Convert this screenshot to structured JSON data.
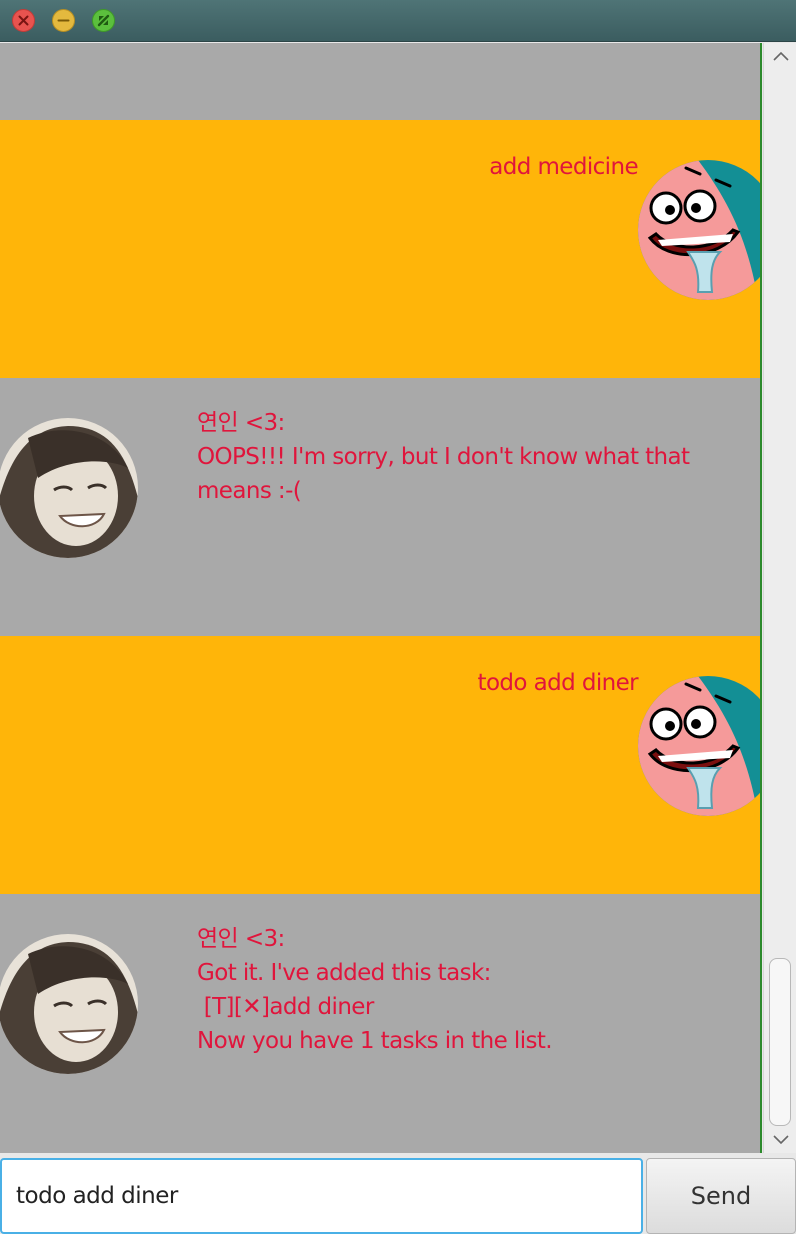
{
  "window": {
    "controls": [
      "close",
      "minimize",
      "maximize"
    ]
  },
  "colors": {
    "user_bubble": "#ffb509",
    "bot_bubble": "#a9a9a9",
    "message_text": "#e0153c",
    "input_focus": "#4ab0e6"
  },
  "messages": [
    {
      "sender": "user",
      "text": "add medicine",
      "avatar": "patrick-avatar"
    },
    {
      "sender": "bot",
      "text": "연인 <3:\nOOPS!!! I'm sorry, but I don't know what that\nmeans :-(",
      "avatar": "bot-girl-avatar"
    },
    {
      "sender": "user",
      "text": "todo add diner",
      "avatar": "patrick-avatar"
    },
    {
      "sender": "bot",
      "text": "연인 <3:\nGot it. I've added this task:\n [T][✕]add diner\nNow you have 1 tasks in the list.",
      "avatar": "bot-girl-avatar"
    }
  ],
  "input": {
    "value": "todo add diner",
    "placeholder": ""
  },
  "send_button": {
    "label": "Send"
  }
}
